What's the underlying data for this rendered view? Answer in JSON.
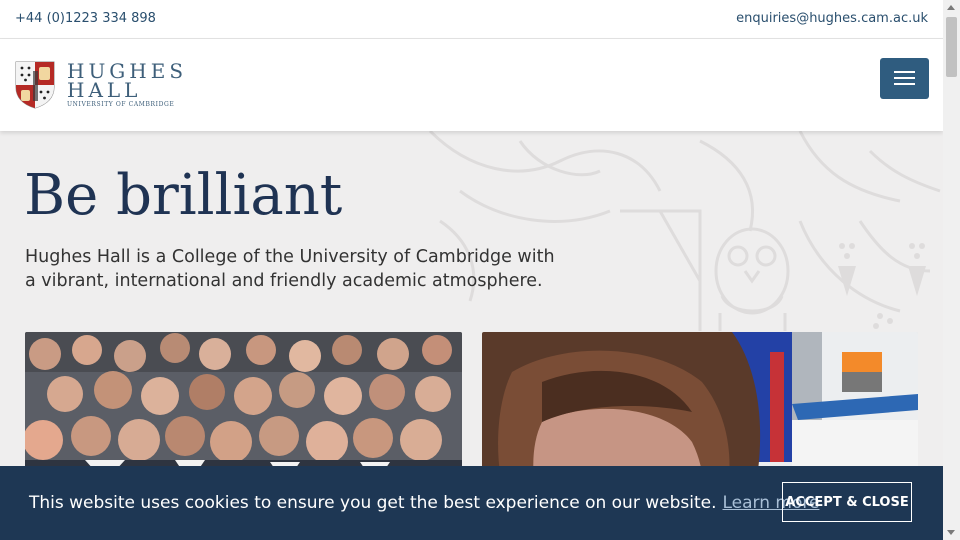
{
  "contact": {
    "phone": "+44 (0)1223 334 898",
    "email": "enquiries@hughes.cam.ac.uk"
  },
  "logo": {
    "line1": "HUGHES",
    "line2": "HALL",
    "subtitle": "UNIVERSITY OF CAMBRIDGE"
  },
  "menu": {
    "icon": "hamburger-menu-icon"
  },
  "hero": {
    "title": "Be brilliant",
    "description": "Hughes Hall is a College of the University of Cambridge with a vibrant, international and friendly academic atmosphere."
  },
  "cookie": {
    "message": "This website uses cookies to ensure you get the best experience on our website.",
    "learn_more": "Learn more",
    "accept_label": "ACCEPT & CLOSE"
  },
  "colors": {
    "brand_navy": "#1f3353",
    "menu_button": "#2f5c7f",
    "cookie_banner": "#1e3754",
    "link": "#2a4f6e"
  }
}
